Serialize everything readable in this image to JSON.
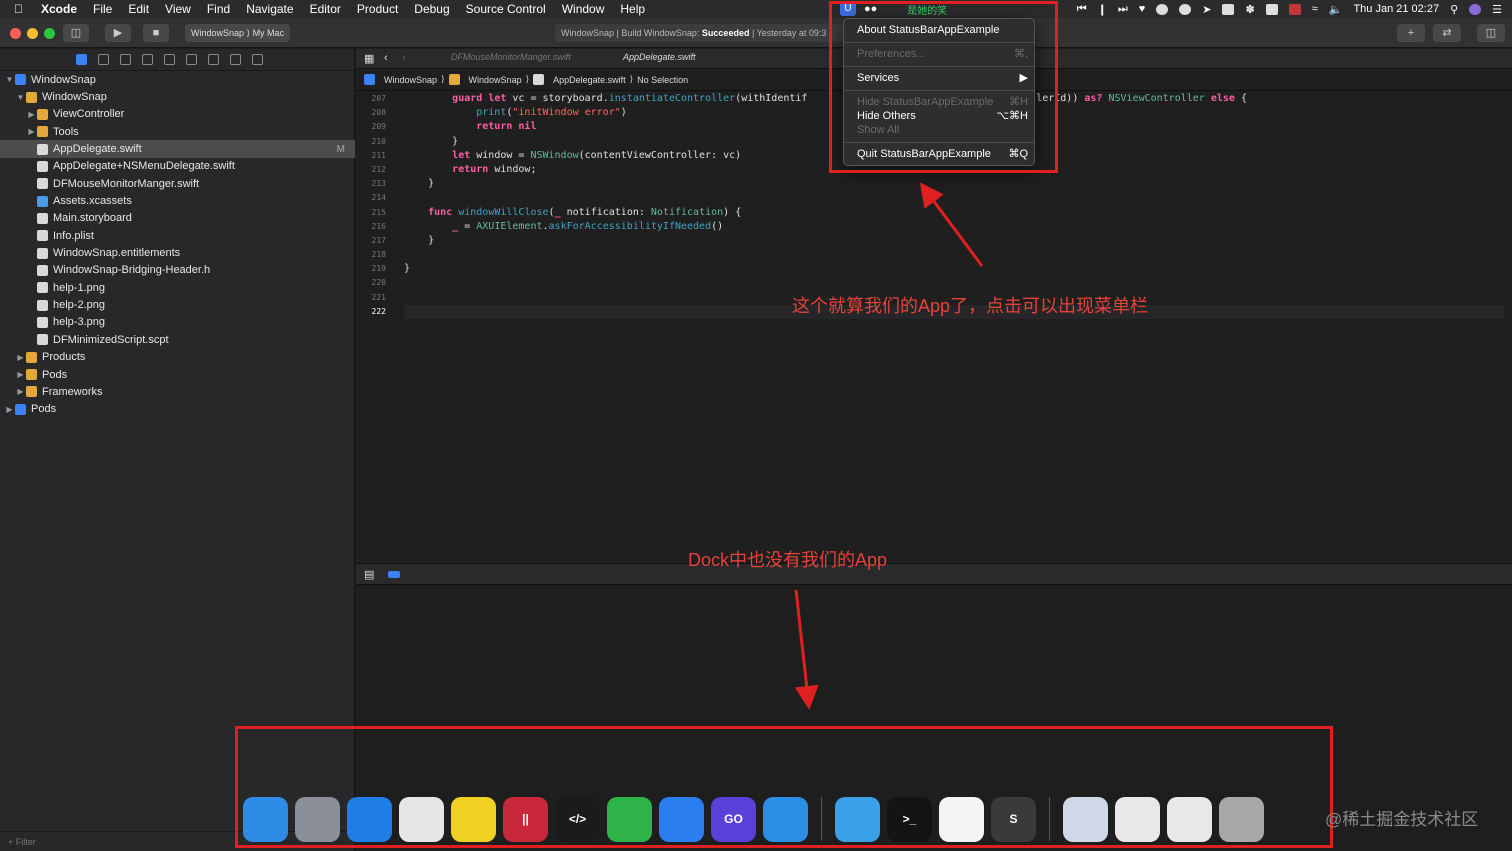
{
  "menubar": {
    "app_name": "Xcode",
    "items": [
      "File",
      "Edit",
      "View",
      "Find",
      "Navigate",
      "Editor",
      "Product",
      "Debug",
      "Source Control",
      "Window",
      "Help"
    ],
    "song_title": "是她的笑",
    "clock": "Thu Jan 21  02:27"
  },
  "toolbar": {
    "scheme": "WindowSnap",
    "destination": "My Mac",
    "activity_prefix": "WindowSnap | Build WindowSnap: ",
    "activity_status": "Succeeded",
    "activity_suffix": " | Yesterday at 09:3"
  },
  "navigator": {
    "filter_placeholder": "Filter",
    "rows": [
      {
        "label": "WindowSnap",
        "kind": "proj"
      },
      {
        "label": "WindowSnap",
        "kind": "folder"
      },
      {
        "label": "ViewController",
        "kind": "folder"
      },
      {
        "label": "Tools",
        "kind": "folder"
      },
      {
        "label": "AppDelegate.swift",
        "kind": "file",
        "badge": "M"
      },
      {
        "label": "AppDelegate+NSMenuDelegate.swift",
        "kind": "file"
      },
      {
        "label": "DFMouseMonitorManger.swift",
        "kind": "file"
      },
      {
        "label": "Assets.xcassets",
        "kind": "asset"
      },
      {
        "label": "Main.storyboard",
        "kind": "file"
      },
      {
        "label": "Info.plist",
        "kind": "file"
      },
      {
        "label": "WindowSnap.entitlements",
        "kind": "file"
      },
      {
        "label": "WindowSnap-Bridging-Header.h",
        "kind": "file"
      },
      {
        "label": "help-1.png",
        "kind": "file"
      },
      {
        "label": "help-2.png",
        "kind": "file"
      },
      {
        "label": "help-3.png",
        "kind": "file"
      },
      {
        "label": "DFMinimizedScript.scpt",
        "kind": "file"
      },
      {
        "label": "Products",
        "kind": "folder"
      },
      {
        "label": "Pods",
        "kind": "folder"
      },
      {
        "label": "Frameworks",
        "kind": "folder"
      },
      {
        "label": "Pods",
        "kind": "proj"
      }
    ]
  },
  "editor": {
    "tabs": [
      "DFMouseMonitorManger.swift",
      "AppDelegate.swift"
    ],
    "jumpbar": [
      "WindowSnap",
      "WindowSnap",
      "AppDelegate.swift",
      "No Selection"
    ],
    "line_numbers": [
      "207",
      "208",
      "209",
      "210",
      "211",
      "212",
      "213",
      "214",
      "215",
      "216",
      "217",
      "218",
      "219",
      "220",
      "221",
      "222"
    ],
    "current_line": "222"
  },
  "status_menu": {
    "items": [
      {
        "label": "About StatusBarAppExample",
        "shortcut": "",
        "enabled": true
      },
      {
        "label": "Preferences...",
        "shortcut": "⌘,",
        "enabled": false
      },
      {
        "label": "Services",
        "shortcut": "▶",
        "enabled": true
      },
      {
        "label": "Hide StatusBarAppExample",
        "shortcut": "⌘H",
        "enabled": false
      },
      {
        "label": "Hide Others",
        "shortcut": "⌥⌘H",
        "enabled": true
      },
      {
        "label": "Show All",
        "shortcut": "",
        "enabled": false
      },
      {
        "label": "Quit StatusBarAppExample",
        "shortcut": "⌘Q",
        "enabled": true
      }
    ]
  },
  "dock": {
    "apps": [
      {
        "name": "finder-icon",
        "color": "#2f8ce6",
        "glyph": ""
      },
      {
        "name": "launchpad-icon",
        "color": "#8a8f99",
        "glyph": ""
      },
      {
        "name": "safari-icon",
        "color": "#1f7fe6",
        "glyph": ""
      },
      {
        "name": "chrome-icon",
        "color": "#e6e6e6",
        "glyph": ""
      },
      {
        "name": "music-player-icon",
        "color": "#f0d020",
        "glyph": ""
      },
      {
        "name": "parallels-icon",
        "color": "#c8283a",
        "glyph": "||"
      },
      {
        "name": "script-editor-icon",
        "color": "#1b1b1b",
        "glyph": "</>"
      },
      {
        "name": "wechat-icon",
        "color": "#2db34a",
        "glyph": ""
      },
      {
        "name": "xcode-icon",
        "color": "#2a7ef0",
        "glyph": ""
      },
      {
        "name": "goland-icon",
        "color": "#5b3fd9",
        "glyph": "GO"
      },
      {
        "name": "vscode-icon",
        "color": "#2c8fe6",
        "glyph": ""
      },
      {
        "name": "qq-icon",
        "color": "#3aa0e8",
        "glyph": ""
      },
      {
        "name": "terminal-icon",
        "color": "#141414",
        "glyph": ">_"
      },
      {
        "name": "notes-icon",
        "color": "#f4f4f4",
        "glyph": ""
      },
      {
        "name": "sublime-icon",
        "color": "#3a3a3a",
        "glyph": "S"
      },
      {
        "name": "archive-icon",
        "color": "#cfd8e6",
        "glyph": ""
      },
      {
        "name": "document-icon",
        "color": "#e8e8e8",
        "glyph": ""
      },
      {
        "name": "document-icon-2",
        "color": "#e8e8e8",
        "glyph": ""
      },
      {
        "name": "trash-icon",
        "color": "#a8a8a8",
        "glyph": ""
      }
    ]
  },
  "annotations": {
    "app_note": "这个就算我们的App了，点击可以出现菜单栏",
    "dock_note": "Dock中也没有我们的App",
    "watermark": "@稀土掘金技术社区",
    "accent": "#e02020"
  }
}
